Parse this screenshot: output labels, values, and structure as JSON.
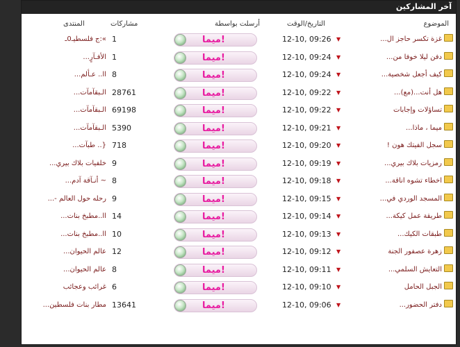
{
  "title": "آخر المشاركين",
  "headers": {
    "topic": "الموضوع",
    "datetime": "التاريخ/الوقت",
    "sent_by": "أرسلت بواسطة",
    "posts": "مشاركات",
    "forum": "المنتدى"
  },
  "colors": {
    "accent": "#e81aa0",
    "link": "#7a1b1b",
    "arrow": "#c0141c",
    "titlebar": "#232323"
  },
  "icons": {
    "topic": "folder-icon",
    "jump": "triangle-down-icon",
    "user": "globe-icon"
  },
  "rows": [
    {
      "topic": "غزة تكسر حاجز ال...",
      "time": "12-10, 09:26",
      "user": "ميما!",
      "posts": "1",
      "forum": "»:ج فلسطيـ0ـ"
    },
    {
      "topic": "دفن ليلا خوفا من...",
      "time": "12-10, 09:24",
      "user": "ميما!",
      "posts": "1",
      "forum": "الأفـآرٍ..."
    },
    {
      "topic": "كيف أجعل شخصية...",
      "time": "12-10, 09:24",
      "user": "ميما!",
      "posts": "8",
      "forum": "اا.. عـألم..."
    },
    {
      "topic": "هل أنت...(مع)...",
      "time": "12-10, 09:22",
      "user": "ميما!",
      "posts": "28761",
      "forum": "الـبقآمآت..."
    },
    {
      "topic": "تساؤلات وإجابات",
      "time": "12-10, 09:22",
      "user": "ميما!",
      "posts": "69198",
      "forum": "الـبقآمآت..."
    },
    {
      "topic": "ميما ، ماذا...",
      "time": "12-10, 09:21",
      "user": "ميما!",
      "posts": "5390",
      "forum": "الـبقآمآت..."
    },
    {
      "topic": "سجل الفيتك هون !",
      "time": "12-10, 09:20",
      "user": "ميما!",
      "posts": "718",
      "forum": "{.. طبآت..."
    },
    {
      "topic": "رمزيات بلاك بيري...",
      "time": "12-10, 09:19",
      "user": "ميما!",
      "posts": "9",
      "forum": "خلفيات بلاك بيري..."
    },
    {
      "topic": "اخطاء تشوه اناقة...",
      "time": "12-10, 09:18",
      "user": "ميما!",
      "posts": "8",
      "forum": "~ أنـآقة آدم..."
    },
    {
      "topic": "المسجد الوردي في...",
      "time": "12-10, 09:15",
      "user": "ميما!",
      "posts": "9",
      "forum": "رحله حول العالم -..."
    },
    {
      "topic": "طريقة عمل كيكة...",
      "time": "12-10, 09:14",
      "user": "ميما!",
      "posts": "14",
      "forum": "اا..مطبخ بنات..."
    },
    {
      "topic": "طبقات الكيك...",
      "time": "12-10, 09:13",
      "user": "ميما!",
      "posts": "10",
      "forum": "اا..مطبخ بنات..."
    },
    {
      "topic": "زهرة عصفور الجنة",
      "time": "12-10, 09:12",
      "user": "ميما!",
      "posts": "12",
      "forum": "عالم الحيوان..."
    },
    {
      "topic": "التعايش السلمي...",
      "time": "12-10, 09:11",
      "user": "ميما!",
      "posts": "8",
      "forum": "عالم الحيوان..."
    },
    {
      "topic": "الجبل الحامل",
      "time": "12-10, 09:10",
      "user": "ميما!",
      "posts": "6",
      "forum": "غرائب وعجائب"
    },
    {
      "topic": "دفتر الحضور...",
      "time": "12-10, 09:06",
      "user": "ميما!",
      "posts": "13641",
      "forum": "مطار بنات فلسطين..."
    }
  ]
}
